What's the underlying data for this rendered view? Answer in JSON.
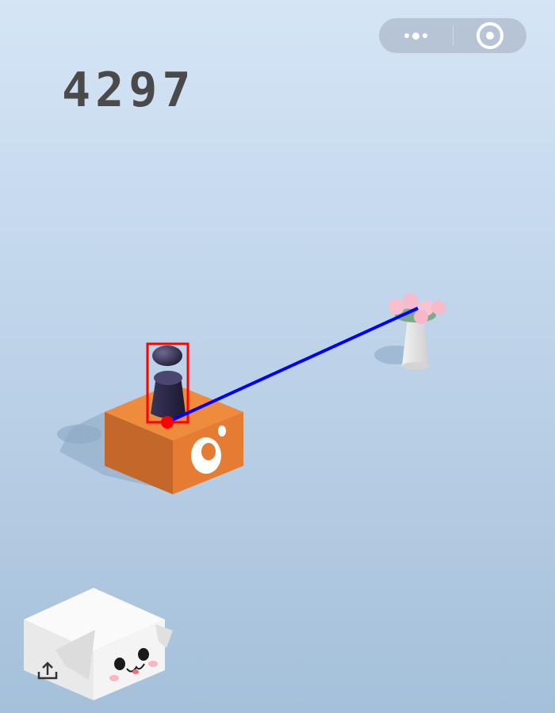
{
  "game": {
    "score": "4297",
    "menu_icon": "more-dots-icon",
    "close_icon": "target-circle-icon",
    "share_icon": "share-upload-icon"
  },
  "colors": {
    "background_top": "#d3e3f4",
    "background_bottom": "#a9c4dd",
    "score": "#4a4a4a",
    "orange_box_top": "#ee8b3d",
    "orange_box_left": "#c86a2a",
    "orange_box_right": "#e37a32",
    "player": "#2e2a4a",
    "bounding_box": "#ff0000",
    "trajectory": "#0000ff",
    "vase": "#e8e8e8",
    "flowers": "#f8c0cf"
  }
}
